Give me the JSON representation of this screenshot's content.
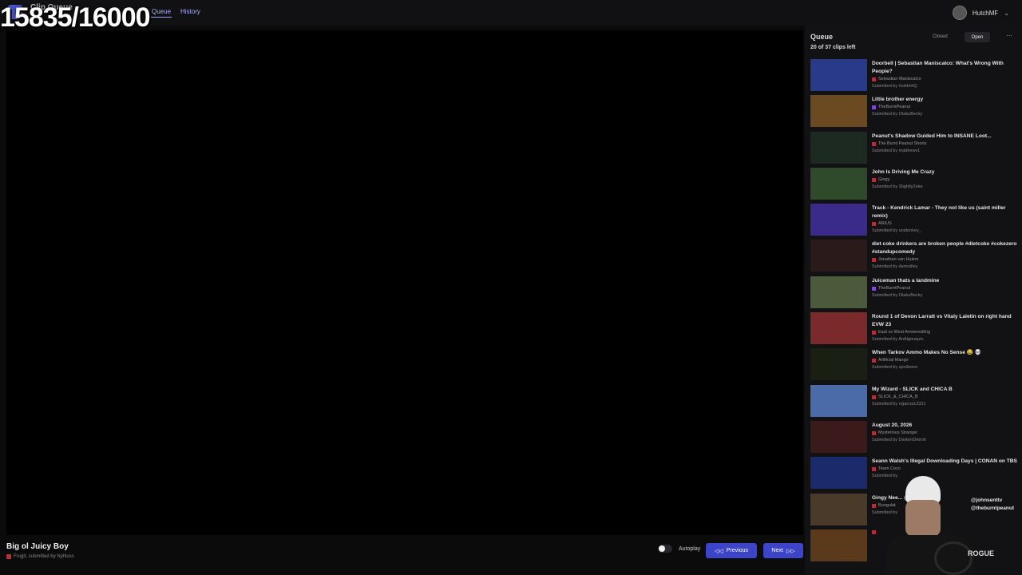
{
  "overlay": {
    "counter": "15835/16000"
  },
  "header": {
    "app_title": "Clip Queue",
    "app_subtitle": "",
    "nav": {
      "queue": "Queue",
      "history": "History"
    },
    "user": {
      "name": "HutchMF",
      "chevron": "⌄"
    }
  },
  "player": {
    "clip_title": "Big ol Juicy Boy",
    "clip_meta": "Frugit, submitted by Nyhluss"
  },
  "controls": {
    "autoplay_label": "Autoplay",
    "autoplay_on": false,
    "previous_label": "Previous",
    "next_label": "Next",
    "previous_icon": "◁◁",
    "next_icon": "▷▷"
  },
  "queue": {
    "title": "Queue",
    "closed_label": "Closed",
    "open_label": "Open",
    "more_icon": "⋯",
    "count_text": "20 of 37 clips left",
    "items": [
      {
        "title": "Doorbell | Sebastian Maniscalco: What's Wrong With People?",
        "channel": "Sebastian Maniscalco",
        "submitted": "Submitted by GoldnHQ",
        "thumb": "#2a3a8a",
        "platform": "youtube"
      },
      {
        "title": "Little brother energy",
        "channel": "TheBurntPeanut",
        "submitted": "Submitted by OtakuBecky",
        "thumb": "#6b4a22",
        "platform": "twitch"
      },
      {
        "title": "Peanut's Shadow Guided Him to INSANE Loot...",
        "channel": "The Burnt Peanut Shorts",
        "submitted": "Submitted by matthewv1",
        "thumb": "#1c2a22",
        "platform": "youtube"
      },
      {
        "title": "John Is Driving Me Crazy",
        "channel": "Gingy",
        "submitted": "Submitted by SlightlyZeke",
        "thumb": "#2f4a2a",
        "platform": "youtube"
      },
      {
        "title": "Track - Kendrick Lamar - They not like us (saint miller remix)",
        "channel": "ARIUS",
        "submitted": "Submitted by unidonkey_",
        "thumb": "#3a2a8a",
        "platform": "youtube"
      },
      {
        "title": "diet coke drinkers are broken people #dietcoke #cokezero #standupcomedy",
        "channel": "Jonathan van Halem",
        "submitted": "Submitted by damuttley",
        "thumb": "#2a1a1a",
        "platform": "youtube"
      },
      {
        "title": "Juiceman thats a landmine",
        "channel": "TheBurntPeanut",
        "submitted": "Submitted by OtakuBecky",
        "thumb": "#4a5a3a",
        "platform": "twitch"
      },
      {
        "title": "Round 1 of Devon Larratt vs Vitaly Laletin on right hand EVW 23",
        "channel": "East vs West Armwrestling",
        "submitted": "Submitted by AnAlgonquin",
        "thumb": "#7a2a2a",
        "platform": "youtube"
      },
      {
        "title": "When Tarkov Ammo Makes No Sense 😂 💀",
        "channel": "Artificial Mango",
        "submitted": "Submitted by xpolloooo",
        "thumb": "#1a1f14",
        "platform": "youtube"
      },
      {
        "title": "My Wizard - SLICK and CHICA B",
        "channel": "SLICK_&_CHICA_B",
        "submitted": "Submitted by rrgarcia12321",
        "thumb": "#4a6aa8",
        "platform": "youtube"
      },
      {
        "title": "August 20, 2026",
        "channel": "Mysterious Stranger",
        "submitted": "Submitted by DarkenDetroit",
        "thumb": "#3a1a1a",
        "platform": "youtube"
      },
      {
        "title": "Seann Walsh's Illegal Downloading Days | CONAN on TBS",
        "channel": "Team Coco",
        "submitted": "Submitted by",
        "thumb": "#1a2a6a",
        "platform": "youtube"
      },
      {
        "title": "Gingy Nee... @Cloakzy",
        "channel": "Bungulat",
        "submitted": "Submitted by",
        "thumb": "#4a3a2a",
        "platform": "youtube"
      },
      {
        "title": "",
        "channel": "",
        "submitted": "",
        "thumb": "#5a3a1a",
        "platform": "youtube"
      }
    ]
  },
  "webcam": {
    "overlay_text": "@johnsenttv @theburntpeanut",
    "shirt_text": "ROGUE"
  }
}
